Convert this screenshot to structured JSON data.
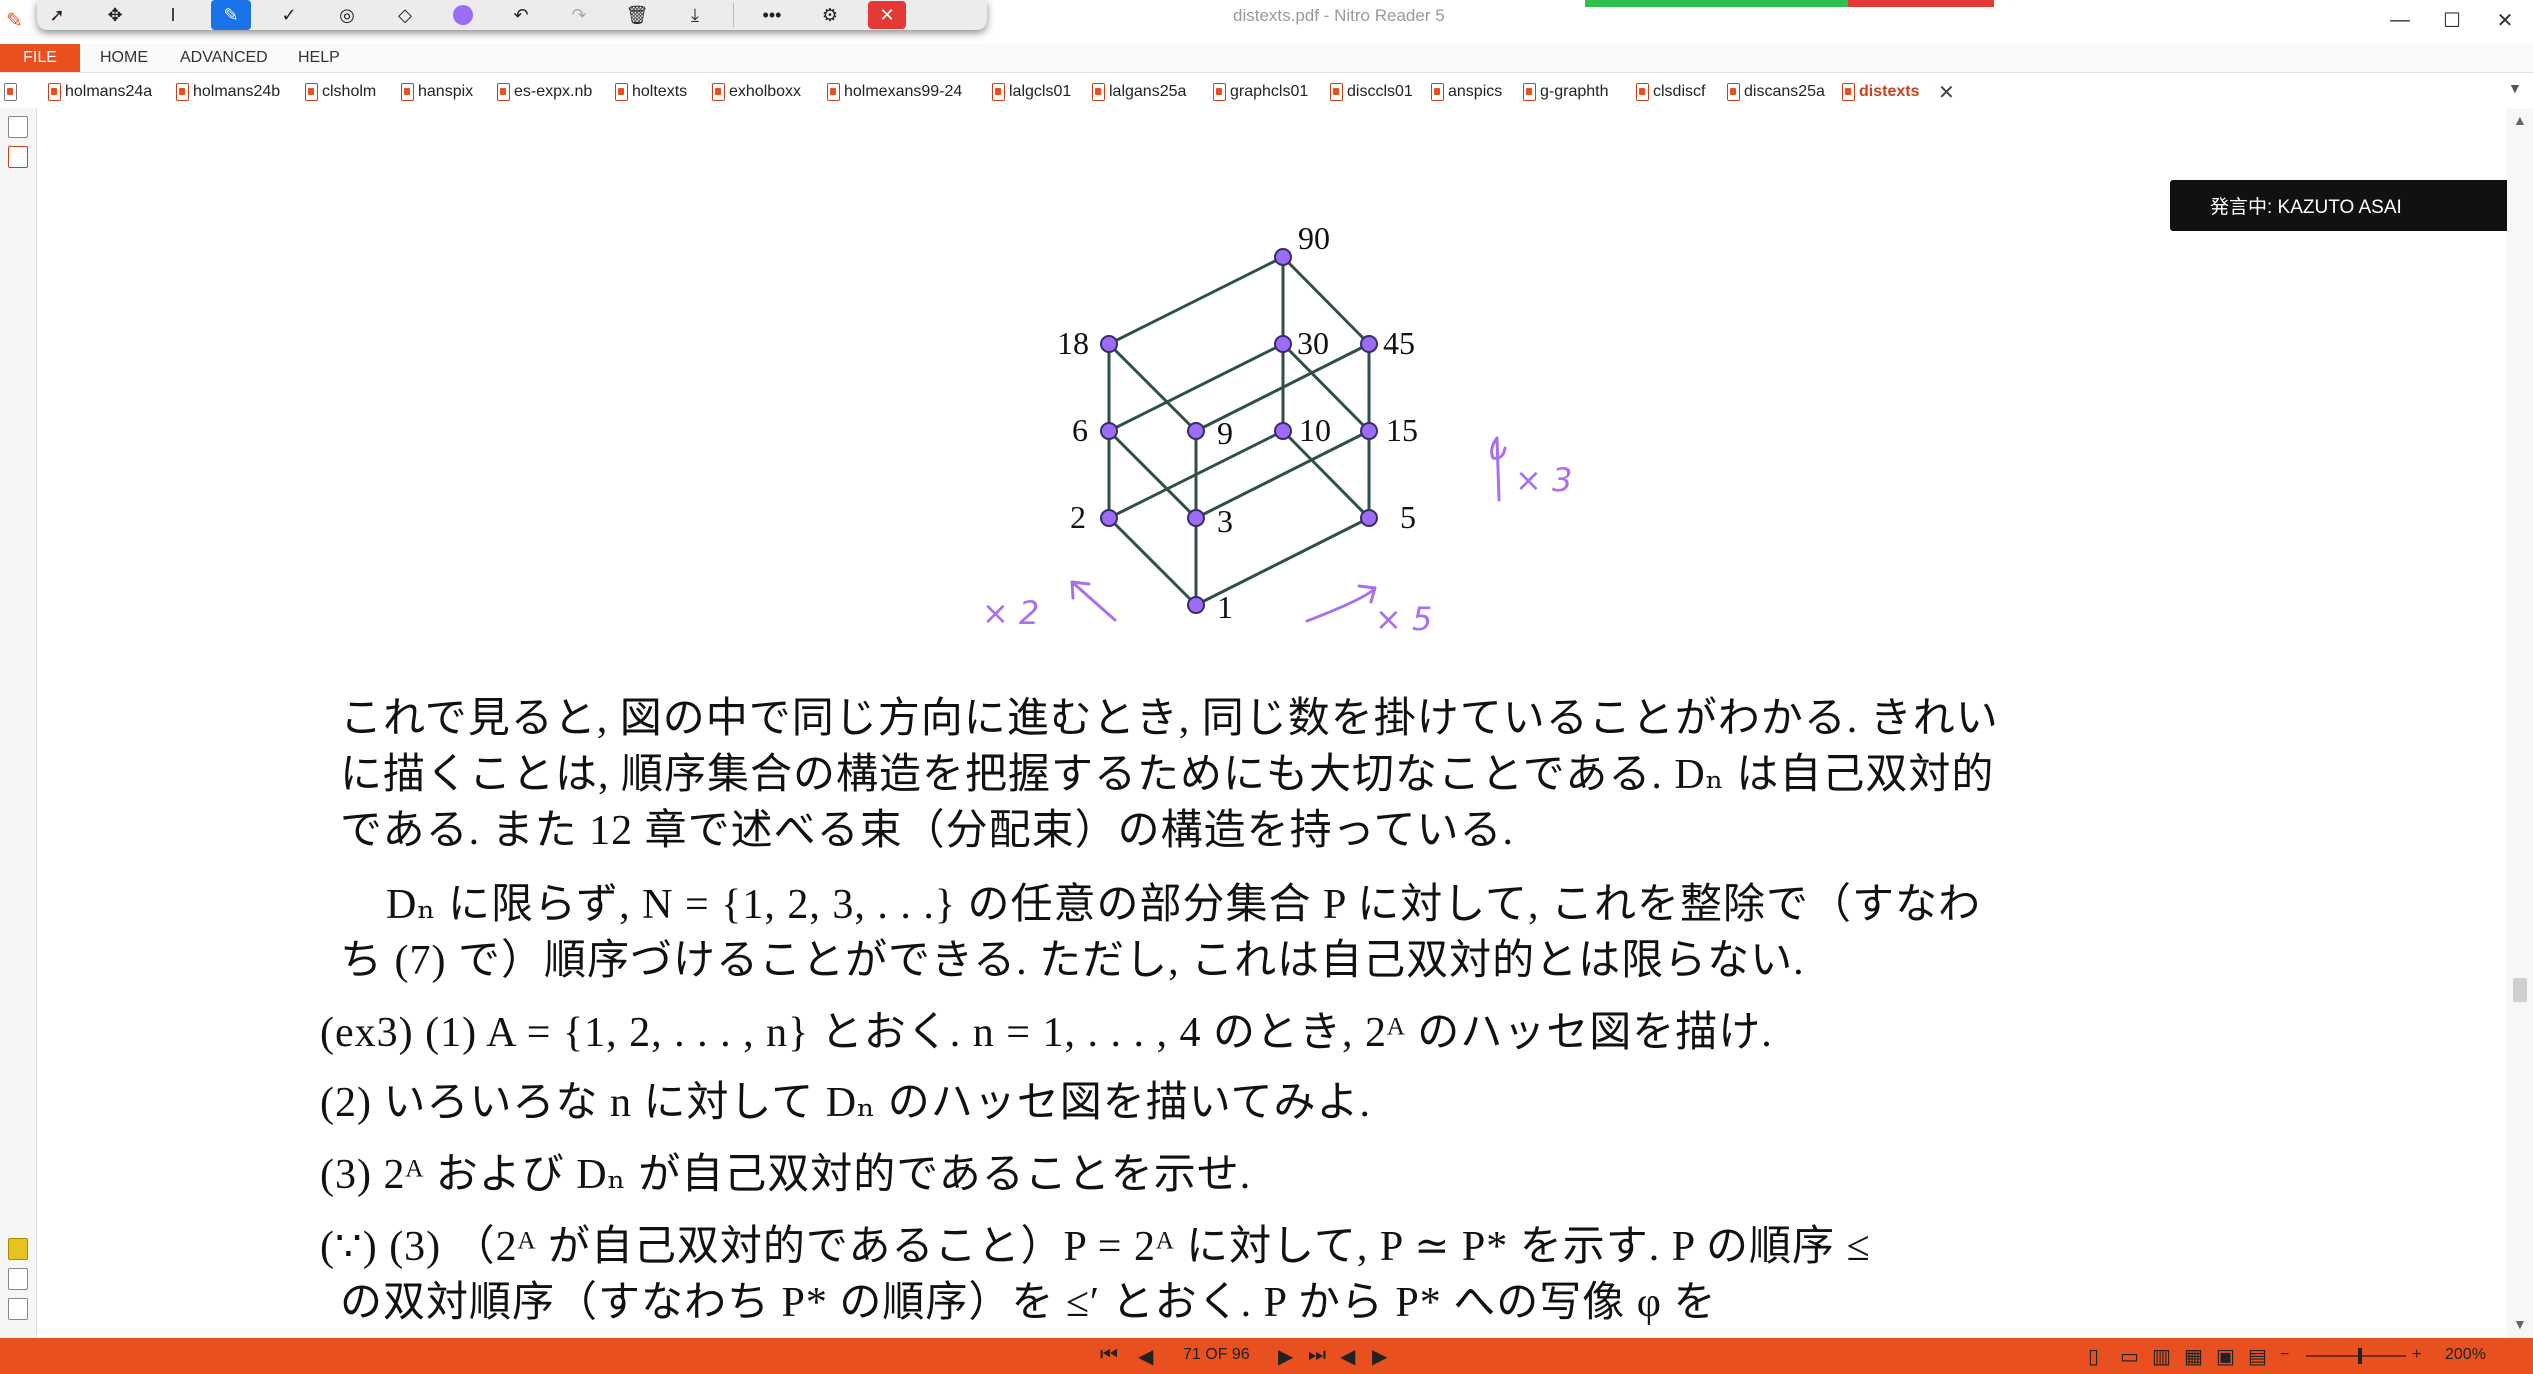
{
  "window": {
    "title": "distexts.pdf - Nitro Reader 5",
    "minimize": "—",
    "maximize": "☐",
    "close": "✕"
  },
  "ribbon": {
    "file": "FILE",
    "tabs": [
      "HOME",
      "ADVANCED",
      "HELP"
    ]
  },
  "doc_tabs": [
    "holmans24a",
    "holmans24b",
    "clsholm",
    "hanspix",
    "es-expx.nb",
    "holtexts",
    "exholboxx",
    "holmexans99-24",
    "lalgcls01",
    "lalgans25a",
    "graphcls01",
    "disccls01",
    "anspics",
    "g-graphth",
    "clsdiscf",
    "discans25a",
    "distexts"
  ],
  "active_tab": "distexts",
  "speaker_badge": "発言中: KAZUTO ASAI",
  "hasse_labels": [
    "90",
    "18",
    "30",
    "45",
    "6",
    "9",
    "10",
    "15",
    "2",
    "3",
    "5",
    "1"
  ],
  "annotations": {
    "ann1": "× 2",
    "ann2": "× 5",
    "ann3": "× 3"
  },
  "text_lines": [
    "これで見ると, 図の中で同じ方向に進むとき, 同じ数を掛けていることがわかる. きれい",
    "に描くことは, 順序集合の構造を把握するためにも大切なことである. Dₙ は自己双対的",
    "である. また 12 章で述べる束（分配束）の構造を持っている.",
    "Dₙ に限らず, N = {1, 2, 3, . . .} の任意の部分集合 P に対して, これを整除で（すなわ",
    "ち (7) で）順序づけることができる. ただし, これは自己双対的とは限らない.",
    "(ex3) (1) A = {1, 2, . . . , n} とおく. n = 1, . . . , 4 のとき, 2ᴬ のハッセ図を描け.",
    "(2) いろいろな n に対して Dₙ のハッセ図を描いてみよ.",
    "(3) 2ᴬ および Dₙ が自己双対的であることを示せ.",
    "(∵) (3) （2ᴬ が自己双対的であること）P = 2ᴬ に対して, P ≃ P* を示す. P の順序 ≤",
    "の双対順序（すなわち P* の順序）を ≤′ とおく. P から P* への写像 φ を"
  ],
  "status": {
    "page": "71 OF 96",
    "zoom": "200%"
  },
  "colors": {
    "accent": "#e8501f",
    "node_fill": "#9b6df5",
    "ink": "#a870f0"
  }
}
